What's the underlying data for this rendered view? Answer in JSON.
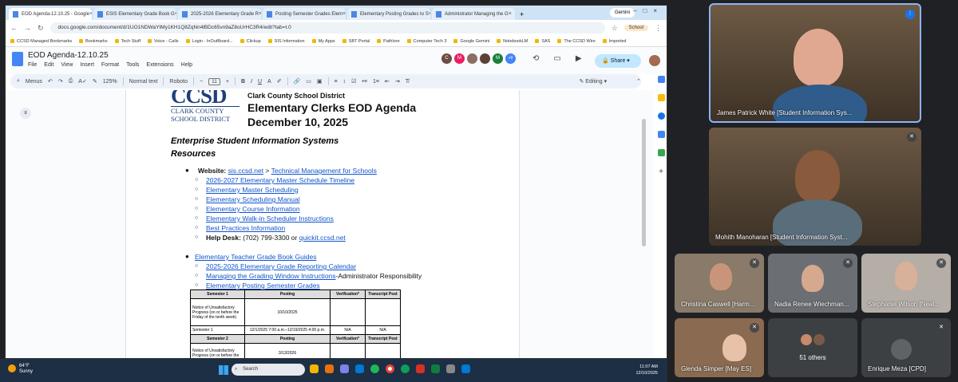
{
  "browser": {
    "tabs": [
      {
        "label": "EOD Agenda-12.10.25 - Google",
        "active": true
      },
      {
        "label": "ESIS Elementary Grade Book G"
      },
      {
        "label": "2025-2026 Elementary Grade R"
      },
      {
        "label": "Posting Semester Grades Elem"
      },
      {
        "label": "Elementary Posting Grades to S"
      },
      {
        "label": "Administrator Managing the G"
      }
    ],
    "gemini": "Gemini",
    "url": "docs.google.com/document/d/1UO1NDWaYtMy1KH1Q8ZqNn4lBDc65vn9aZ8oUrHC3R4/edit?tab=t.0",
    "profile": "School",
    "bookmarks": [
      "CCSD Managed Bookmarks",
      "Bookmarks",
      "Tech Stuff",
      "Voice - Calls",
      "Login - InOutBoard...",
      "Clickup",
      "SIS Information",
      "My Apps",
      "SBT Portal",
      "Pathlore",
      "Computer Tech 3",
      "Google Gemini",
      "NotebookLM",
      "SAS",
      "The CCSD Wire",
      "Imported"
    ]
  },
  "docs": {
    "title": "EOD Agenda-12.10.25",
    "menus": [
      "File",
      "Edit",
      "View",
      "Insert",
      "Format",
      "Tools",
      "Extensions",
      "Help"
    ],
    "avatars": [
      {
        "initial": "C",
        "color": "#6d4c41"
      },
      {
        "initial": "M",
        "color": "#e91e63"
      },
      {
        "initial": "",
        "color": "#8d6e63"
      },
      {
        "initial": "",
        "color": "#5d4037"
      },
      {
        "initial": "M",
        "color": "#188038"
      }
    ],
    "more_count": "+9",
    "share": "Share",
    "toolbar": {
      "menus": "Menus",
      "zoom": "125%",
      "style": "Normal text",
      "font": "Roboto",
      "size": "11",
      "mode": "Editing"
    }
  },
  "doc": {
    "logo": {
      "big": "CCSD",
      "line1": "CLARK COUNTY",
      "line2": "SCHOOL DISTRICT"
    },
    "district": "Clark County School District",
    "heading": "Elementary Clerks EOD Agenda",
    "date": "December 10, 2025",
    "section": "Enterprise Student Information Systems",
    "resources": "Resources",
    "website_label": "Website:",
    "website_link": "sis.ccsd.net",
    "website_sep": " > ",
    "website_page": "Technical Management for Schools",
    "sub1": [
      "2026-2027 Elementary Master Schedule Timeline",
      "Elementary Master Scheduling",
      "Elementary Scheduling Manual",
      "Elementary Course Information",
      "Elementary Walk-in Scheduler Instructions",
      "Best Practices Information"
    ],
    "helpdesk_label": "Help Desk:",
    "helpdesk_text": " (702) 799-3300 or ",
    "helpdesk_link": "quickit.ccsd.net",
    "gradebook": "Elementary Teacher Grade Book Guides",
    "sub2a": "2025-2026 Elementary Grade Reporting Calendar",
    "sub2b_link": "Managing the Grading Window Instructions",
    "sub2b_text": "-Administrator Responsibility",
    "sub2c": "Elementary Posting Semester Grades",
    "table": {
      "headers": [
        "Semester 1",
        "Posting",
        "Verification*",
        "Transcript Post"
      ],
      "rows": [
        [
          "Notice of Unsatisfactory Progress (on or before the Friday of the tenth week)",
          "10/10/2025",
          "",
          ""
        ],
        [
          "Semester 1",
          "12/1/2025 7:00 a.m.–12/19/2025 4:00 p.m.",
          "N/A",
          "N/A"
        ]
      ],
      "headers2": [
        "Semester 2",
        "Posting",
        "Verification*",
        "Transcript Post"
      ],
      "rows2": [
        [
          "Notice of Unsatisfactory Progress (on or before the",
          "3/13/2026",
          "",
          ""
        ]
      ]
    }
  },
  "taskbar": {
    "temp": "64°F",
    "condition": "Sunny",
    "search": "Search",
    "time": "11:07 AM",
    "date": "12/10/2025"
  },
  "meet": {
    "big_tiles": [
      {
        "name": "James Patrick White [Student Information Sys...",
        "speaking": true
      },
      {
        "name": "Mohith Manoharan [Student Information Syst...",
        "speaking": false
      }
    ],
    "small_tiles": [
      {
        "name": "Christina Caswell [Harm..."
      },
      {
        "name": "Nadia Renee Wiechman..."
      },
      {
        "name": "Stephanie Wilson [Neal..."
      },
      {
        "name": "Glenda Simper [May ES]"
      },
      {
        "name": "51 others"
      },
      {
        "name": "Enrique Meza [CPD]"
      }
    ]
  }
}
